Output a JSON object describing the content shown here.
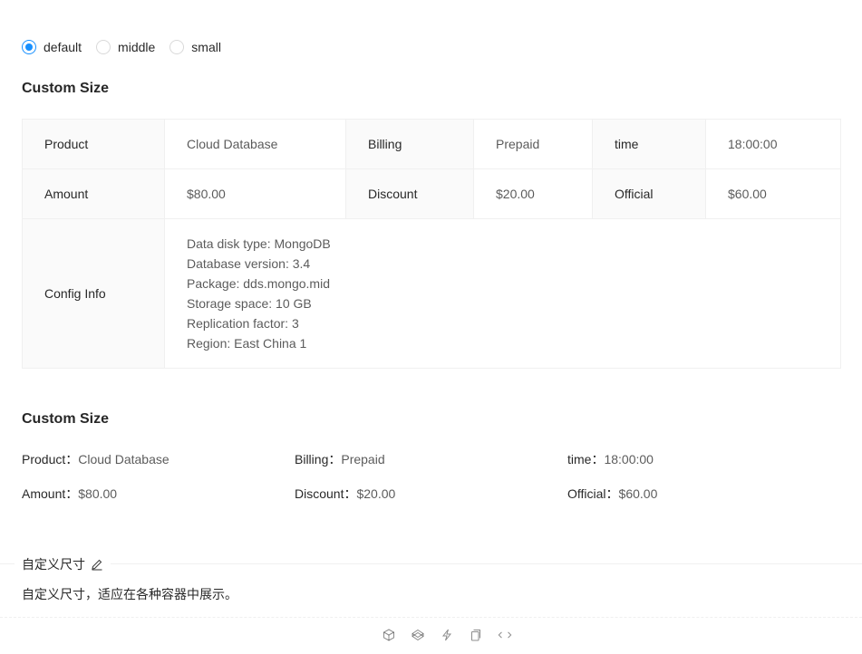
{
  "size_options": [
    {
      "label": "default",
      "checked": true
    },
    {
      "label": "middle",
      "checked": false
    },
    {
      "label": "small",
      "checked": false
    }
  ],
  "bordered": {
    "title": "Custom Size",
    "rows": [
      [
        {
          "label": "Product",
          "value": "Cloud Database"
        },
        {
          "label": "Billing",
          "value": "Prepaid"
        },
        {
          "label": "time",
          "value": "18:00:00"
        }
      ],
      [
        {
          "label": "Amount",
          "value": "$80.00"
        },
        {
          "label": "Discount",
          "value": "$20.00"
        },
        {
          "label": "Official",
          "value": "$60.00"
        }
      ]
    ],
    "config": {
      "label": "Config Info",
      "lines": [
        "Data disk type: MongoDB",
        "Database version: 3.4",
        "Package: dds.mongo.mid",
        "Storage space: 10 GB",
        "Replication factor: 3",
        "Region: East China 1"
      ]
    }
  },
  "plain": {
    "title": "Custom Size",
    "rows": [
      [
        {
          "label": "Product",
          "value": "Cloud Database"
        },
        {
          "label": "Billing",
          "value": "Prepaid"
        },
        {
          "label": "time",
          "value": "18:00:00"
        }
      ],
      [
        {
          "label": "Amount",
          "value": "$80.00"
        },
        {
          "label": "Discount",
          "value": "$20.00"
        },
        {
          "label": "Official",
          "value": "$60.00"
        }
      ]
    ],
    "separator": "："
  },
  "demo": {
    "title": "自定义尺寸",
    "description": "自定义尺寸，适应在各种容器中展示。",
    "actions": [
      "codesandbox-icon",
      "codepen-icon",
      "stackblitz-icon",
      "copy-icon",
      "code-expand-icon"
    ]
  },
  "colors": {
    "primary": "#1890ff",
    "border": "#f0f0f0",
    "label_bg": "#fafafa"
  }
}
